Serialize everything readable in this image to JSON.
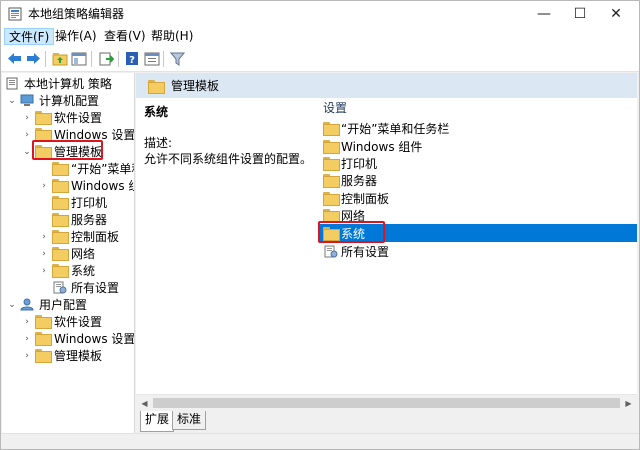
{
  "window": {
    "title": "本地组策略编辑器",
    "controls": {
      "minimize": "—",
      "maximize": "☐",
      "close": "✕"
    }
  },
  "menu": {
    "items": [
      "文件(F)",
      "操作(A)",
      "查看(V)",
      "帮助(H)"
    ],
    "active_index": 0
  },
  "toolbar": {
    "buttons": [
      "back-icon",
      "forward-icon",
      "up-folder-icon",
      "show-hide-tree-icon",
      "export-list-icon",
      "help-icon",
      "properties-icon",
      "filter-icon"
    ]
  },
  "tree": {
    "items": [
      {
        "label": "本地计算机 策略",
        "icon": "computer-policy-icon",
        "expander": ""
      },
      {
        "label": "计算机配置",
        "icon": "computer-icon",
        "expander": "⌄"
      },
      {
        "label": "软件设置",
        "icon": "folder-icon",
        "expander": "›"
      },
      {
        "label": "Windows 设置",
        "icon": "folder-icon",
        "expander": "›"
      },
      {
        "label": "管理模板",
        "icon": "folder-icon",
        "expander": "⌄",
        "highlighted": true
      },
      {
        "label": "“开始”菜单和",
        "icon": "folder-icon",
        "expander": ""
      },
      {
        "label": "Windows 组件",
        "icon": "folder-icon",
        "expander": "›"
      },
      {
        "label": "打印机",
        "icon": "folder-icon",
        "expander": ""
      },
      {
        "label": "服务器",
        "icon": "folder-icon",
        "expander": ""
      },
      {
        "label": "控制面板",
        "icon": "folder-icon",
        "expander": "›"
      },
      {
        "label": "网络",
        "icon": "folder-icon",
        "expander": "›"
      },
      {
        "label": "系统",
        "icon": "folder-icon",
        "expander": "›"
      },
      {
        "label": "所有设置",
        "icon": "all-settings-icon",
        "expander": ""
      },
      {
        "label": "用户配置",
        "icon": "user-icon",
        "expander": "⌄"
      },
      {
        "label": "软件设置",
        "icon": "folder-icon",
        "expander": "›"
      },
      {
        "label": "Windows 设置",
        "icon": "folder-icon",
        "expander": "›"
      },
      {
        "label": "管理模板",
        "icon": "folder-icon",
        "expander": "›"
      }
    ]
  },
  "right": {
    "header": "管理模板",
    "description_title": "系统",
    "description_label": "描述:",
    "description_text": "允许不同系统组件设置的配置。",
    "list_header": "设置",
    "items": [
      {
        "label": "“开始”菜单和任务栏",
        "icon": "folder-icon"
      },
      {
        "label": "Windows 组件",
        "icon": "folder-icon"
      },
      {
        "label": "打印机",
        "icon": "folder-icon"
      },
      {
        "label": "服务器",
        "icon": "folder-icon"
      },
      {
        "label": "控制面板",
        "icon": "folder-icon"
      },
      {
        "label": "网络",
        "icon": "folder-icon"
      },
      {
        "label": "系统",
        "icon": "folder-icon",
        "selected": true
      },
      {
        "label": "所有设置",
        "icon": "all-settings-icon"
      }
    ]
  },
  "tabs": [
    "扩展",
    "标准"
  ],
  "colors": {
    "selection": "#0078d7",
    "highlight_box": "#e0141e",
    "header_strip": "#dbe7f3",
    "folder": "#f4cd62"
  }
}
